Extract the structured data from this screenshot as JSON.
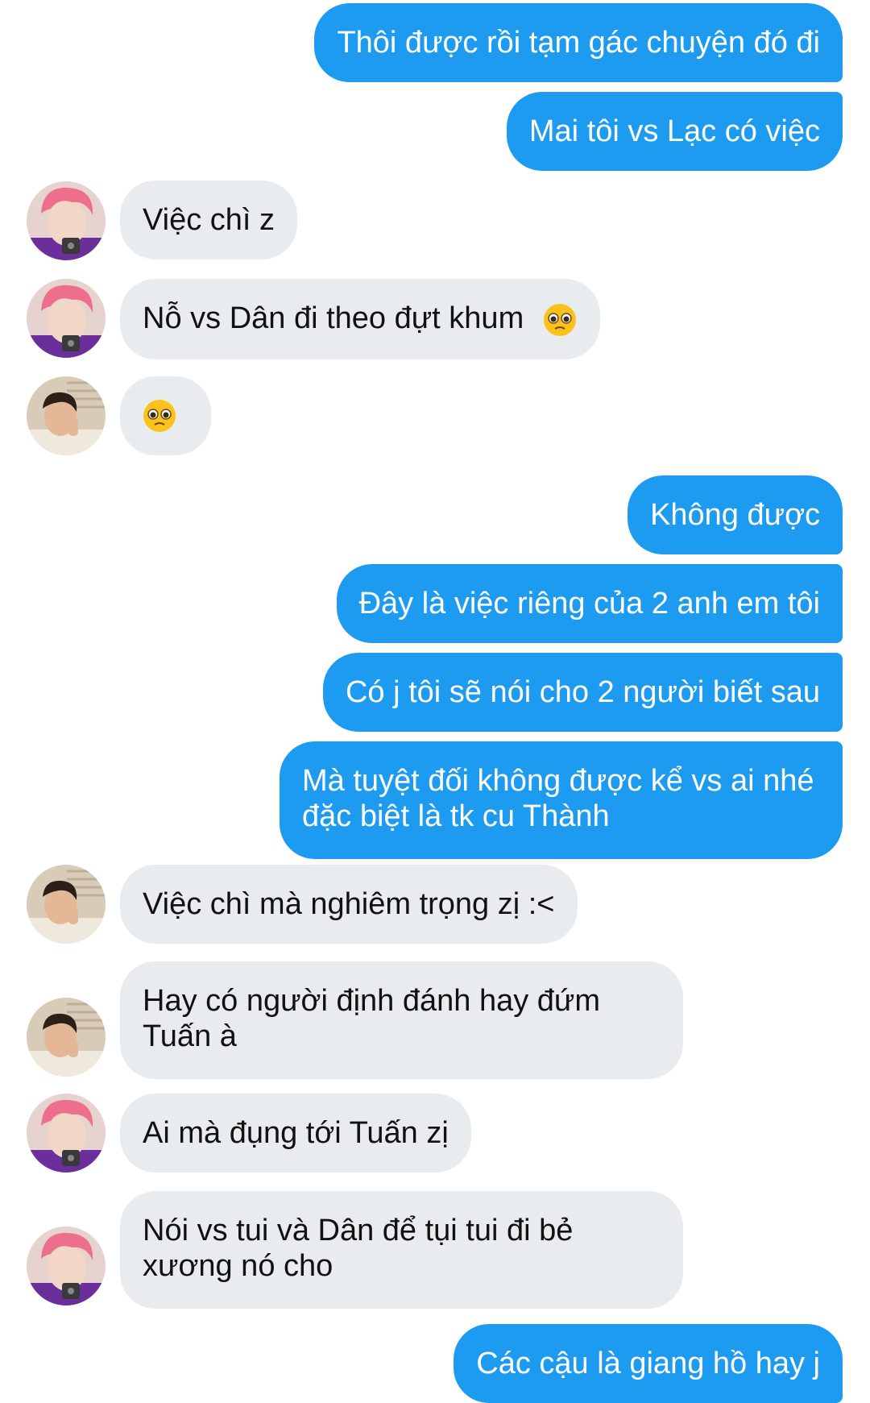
{
  "messages": [
    {
      "from": "me",
      "text": "Thôi được rồi tạm gác chuyện đó đi"
    },
    {
      "from": "me",
      "text": "Mai tôi vs Lạc có việc"
    },
    {
      "from": "pink_hair",
      "text": "Việc chì z"
    },
    {
      "from": "pink_hair",
      "text": "Nỗ vs Dân đi theo đựt khum"
    },
    {
      "from": "dark_hair",
      "text": ""
    },
    {
      "from": "me",
      "text": "Không được"
    },
    {
      "from": "me",
      "text": "Đây là việc riêng của 2 anh em tôi"
    },
    {
      "from": "me",
      "text": "Có j tôi sẽ nói cho 2 người biết sau"
    },
    {
      "from": "me",
      "text": "Mà tuyệt đối không được kể vs ai nhé đặc biệt là tk cu Thành",
      "line1": "Mà tuyệt đối không được kể vs ai nhé",
      "line2": "đặc biệt là tk cu Thành"
    },
    {
      "from": "dark_hair",
      "text": "Việc chì mà nghiêm trọng zị :<"
    },
    {
      "from": "dark_hair",
      "text": "Hay có người định đánh hay đứm Tuấn à",
      "line1": "Hay có người định đánh hay đứm",
      "line2": "Tuấn à"
    },
    {
      "from": "pink_hair",
      "text": "Ai mà đụng tới Tuấn zị"
    },
    {
      "from": "pink_hair",
      "text": "Nói vs tui và Dân để tụi tui đi bẻ xương nó cho",
      "line1": "Nói vs tui và Dân để tụi tui đi bẻ",
      "line2": "xương nó cho"
    },
    {
      "from": "me",
      "text": "Các cậu là giang hồ hay j"
    }
  ],
  "colors": {
    "outgoing_bubble": "#1d9bf0",
    "incoming_bubble": "#e9ecef"
  },
  "icons": {
    "pleading_face": "pleading-face-emoji"
  }
}
